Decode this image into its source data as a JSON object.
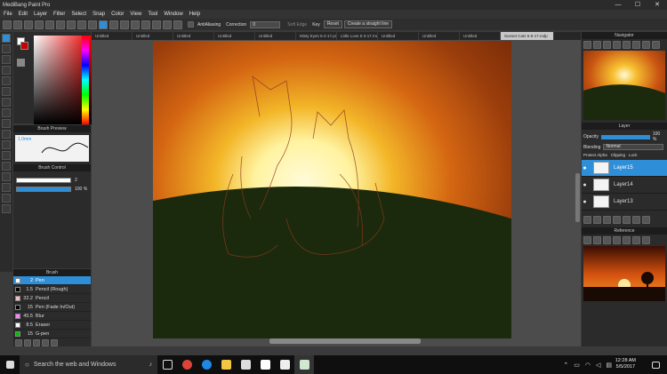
{
  "app": {
    "title": "MediBang Paint Pro"
  },
  "window_controls": {
    "minimize": "—",
    "maximize": "☐",
    "close": "✕"
  },
  "menu": [
    "File",
    "Edit",
    "Layer",
    "Filter",
    "Select",
    "Snap",
    "Color",
    "View",
    "Tool",
    "Window",
    "Help"
  ],
  "toolbar": {
    "antialiasing": "AntiAliasing",
    "correction_label": "Correction",
    "correction_value": "0",
    "soft_edge": "Soft Edge",
    "key": "Key",
    "reset": "Reset",
    "straight_line": "Create a straight line"
  },
  "tabs": [
    "Untitled",
    "Untitled",
    "Untitled",
    "Untitled",
    "Untitled",
    "Misty Eyes 5-2-17.png",
    "Little Love 5-3-17.mdp",
    "Untitled",
    "Untitled",
    "Untitled",
    "Sunset Cats 5-5-17.mdp"
  ],
  "panels": {
    "brush_preview": "Brush Preview",
    "brush_preview_size": "1.0mm",
    "brush_control": "Brush Control",
    "brush_size": "2",
    "brush_opacity": "100 %",
    "brush": "Brush",
    "navigator": "Navigator",
    "layer": "Layer",
    "reference": "Reference"
  },
  "brushes": [
    {
      "size": "2",
      "name": "Pen",
      "color": "#ffffff",
      "selected": true
    },
    {
      "size": "1.5",
      "name": "Pencil (Rough)",
      "color": "#000000",
      "selected": false
    },
    {
      "size": "32.2",
      "name": "Pencil",
      "color": "#f2c0c0",
      "selected": false
    },
    {
      "size": "15",
      "name": "Pen (Fade In/Out)",
      "color": "#000000",
      "selected": false
    },
    {
      "size": "45.5",
      "name": "Blur",
      "color": "#ff80ff",
      "selected": false
    },
    {
      "size": "8.5",
      "name": "Eraser",
      "color": "#ffffff",
      "selected": false
    },
    {
      "size": "15",
      "name": "G-pen",
      "color": "#00c000",
      "selected": false
    }
  ],
  "layer_panel": {
    "opacity_label": "Opacity",
    "opacity_value": "100 %",
    "blending_label": "Blending",
    "blending_value": "Normal",
    "protect_alpha": "Protect Alpha",
    "clipping": "Clipping",
    "lock": "Lock"
  },
  "layers": [
    {
      "name": "Layer15",
      "selected": true
    },
    {
      "name": "Layer14",
      "selected": false
    },
    {
      "name": "Layer13",
      "selected": false
    }
  ],
  "taskbar": {
    "search": "Search the web and Windows",
    "time": "12:28 AM",
    "date": "5/5/2017"
  },
  "colors": {
    "accent": "#2f8ed8",
    "sky_orange": "#d66a12",
    "sun": "#fff9c8",
    "hill": "#1b2a0c"
  }
}
